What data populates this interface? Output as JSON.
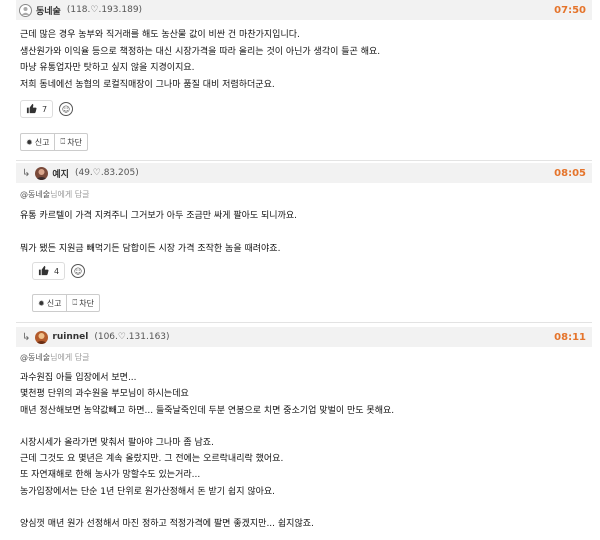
{
  "comments": [
    {
      "nick": "동네술",
      "ip": "(118.♡.193.189)",
      "time": "07:50",
      "lines": [
        "근데 많은 경우 농부와 직거래를 해도 농산물 값이 비싼 건 마찬가지입니다.",
        "생산원가와 이익율 등으로 책정하는 대신 시장가격을 따라 올리는 것이 아닌가 생각이 들곤 해요.",
        "마냥 유통업자만 탓하고 싶지 않을 지경이지요.",
        "저희 동네에선 농협의 로컬직매장이 그나마 품질 대비 저렴하더군요."
      ],
      "likes": "7",
      "report_label": "신고",
      "block_label": "차단"
    },
    {
      "nick": "예지",
      "ip": "(49.♡.83.205)",
      "time": "08:05",
      "reply_to": "@동네술",
      "reply_suffix": "님에게 답글",
      "lines": [
        "유통 카르텔이 가격 지켜주니 그거보가 아두 조금만 싸게 팔아도 되니까요.",
        "",
        "뭐가 됐든 지원금 빼먹기든 담합이든 시장 가격 조작한 놈을 때려야죠."
      ],
      "likes": "4",
      "report_label": "신고",
      "block_label": "차단"
    },
    {
      "nick": "ruinnel",
      "ip": "(106.♡.131.163)",
      "time": "08:11",
      "reply_to": "@동네술",
      "reply_suffix": "님에게 답글",
      "lines": [
        "과수원집 아들 입장에서 보면...",
        "몇천평 단위의 과수원을 부모님이 하시는데요",
        "매년 정산해보면 농약값빼고 하면... 들죽날죽인데 두분 연봉으로 치면 중소기업 맞벌이 만도 못해요.",
        "",
        "시장시세가 올라가면 맞춰서 팔아야 그나마 좀 남죠.",
        "근데 그것도 요 몇년은 계속 올랐지만. 그 전에는 오르락내리락 했어요.",
        "또 자연재해로 한해 농사가 망할수도 있는거라...",
        "농가입장에서는 단순 1년 단위로 원가산정해서 돈 받기 쉽지 않아요.",
        "",
        "양심껏 매년 원가 선정해서 마진 정하고 적정가격에 팔면 좋겠지만... 쉽지않죠."
      ]
    }
  ]
}
